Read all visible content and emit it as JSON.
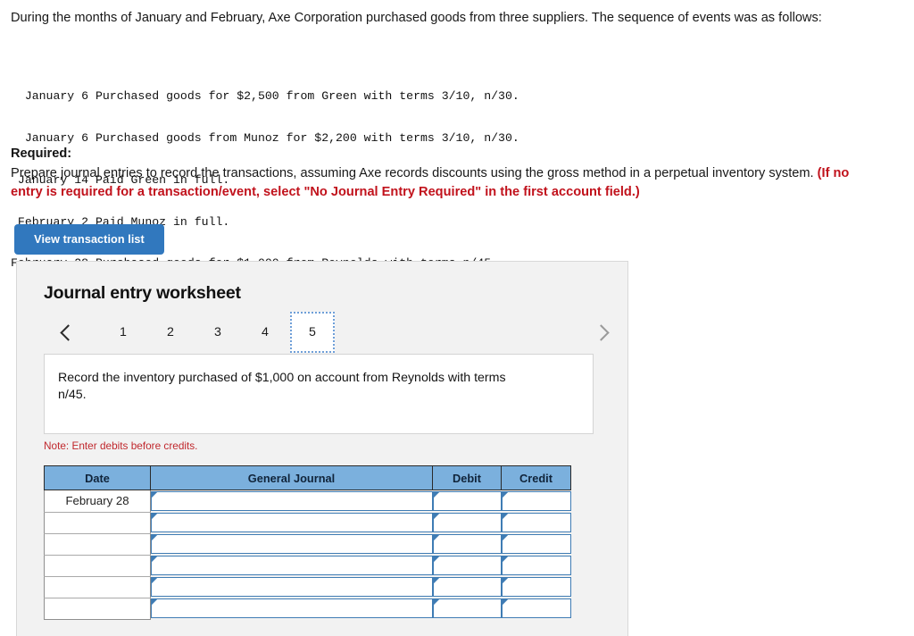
{
  "intro": {
    "paragraph": "During the months of January and February, Axe Corporation purchased goods from three suppliers. The sequence of events was as follows:"
  },
  "transactions": [
    {
      "date": "January 6",
      "description": "Purchased goods for $2,500 from Green with terms 3/10, n/30."
    },
    {
      "date": "January 6",
      "description": "Purchased goods from Munoz for $2,200 with terms 3/10, n/30."
    },
    {
      "date": "January 14",
      "description": "Paid Green in full."
    },
    {
      "date": "February 2",
      "description": "Paid Munoz in full."
    },
    {
      "date": "February 28",
      "description": "Purchased goods for $1,000 from Reynolds with terms n/45."
    }
  ],
  "required": {
    "label": "Required:",
    "body": "Prepare journal entries to record the transactions, assuming Axe records discounts using the gross method in a perpetual inventory system. ",
    "note": "(If no entry is required for a transaction/event, select \"No Journal Entry Required\" in the first account field.)"
  },
  "buttons": {
    "view_transaction_list": "View transaction list"
  },
  "worksheet": {
    "title": "Journal entry worksheet",
    "pager": {
      "prev_icon": "chevron-left-icon",
      "next_icon": "chevron-right-icon",
      "tabs": [
        "1",
        "2",
        "3",
        "4",
        "5"
      ],
      "selected": "5"
    },
    "instruction": "Record the inventory purchased of $1,000 on account from Reynolds with terms n/45.",
    "note": "Note: Enter debits before credits.",
    "table": {
      "headers": [
        "Date",
        "General Journal",
        "Debit",
        "Credit"
      ],
      "rows": [
        {
          "date": "February 28",
          "journal": "",
          "debit": "",
          "credit": ""
        },
        {
          "date": "",
          "journal": "",
          "debit": "",
          "credit": ""
        },
        {
          "date": "",
          "journal": "",
          "debit": "",
          "credit": ""
        },
        {
          "date": "",
          "journal": "",
          "debit": "",
          "credit": ""
        },
        {
          "date": "",
          "journal": "",
          "debit": "",
          "credit": ""
        },
        {
          "date": "",
          "journal": "",
          "debit": "",
          "credit": ""
        }
      ]
    }
  },
  "colors": {
    "button_blue": "#3178be",
    "table_header_blue": "#7bb0dd",
    "input_border_blue": "#3f7cb4",
    "note_red": "#c0282d",
    "required_red": "#c1121c",
    "panel_gray": "#f2f2f2"
  }
}
